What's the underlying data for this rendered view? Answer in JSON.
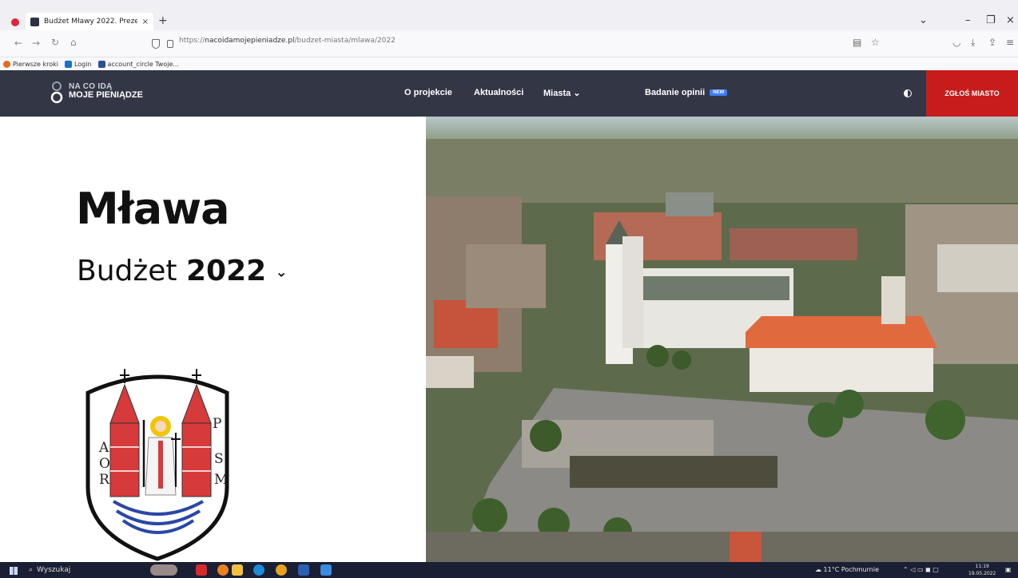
{
  "browser": {
    "tab_title": "Budżet Mławy 2022. Prezentacj",
    "tab_close": "×",
    "new_tab": "+",
    "url_prefix": "https://",
    "url_domain": "nacoidamojepieniadze.pl",
    "url_path": "/budzet-miasta/mlawa/2022",
    "bookmarks": [
      "Pierwsze kroki",
      "Login",
      "account_circle Twoje..."
    ]
  },
  "site": {
    "logo_line1": "NA CO IDĄ",
    "logo_line2": "MOJE PIENIĄDZE",
    "nav": {
      "about": "O projekcie",
      "news": "Aktualności",
      "cities": "Miasta",
      "cities_chevron": "⌄",
      "survey": "Badanie opinii",
      "survey_badge": "NEW"
    },
    "cta": "ZGŁOŚ MIASTO"
  },
  "hero": {
    "city": "Mława",
    "budget_word": "Budżet",
    "year": "2022",
    "year_chevron": "⌄",
    "crest_letters": [
      "A",
      "O",
      "R",
      "P",
      "S",
      "M"
    ]
  },
  "taskbar": {
    "search_placeholder": "Wyszukaj",
    "weather": "11°C Pochmurnie",
    "time": "11:19",
    "date": "19.05.2022"
  },
  "colors": {
    "header_bg": "#323645",
    "cta_bg": "#c61c1c",
    "badge_bg": "#3d7dff",
    "taskbar_bg": "#1b1f33"
  }
}
